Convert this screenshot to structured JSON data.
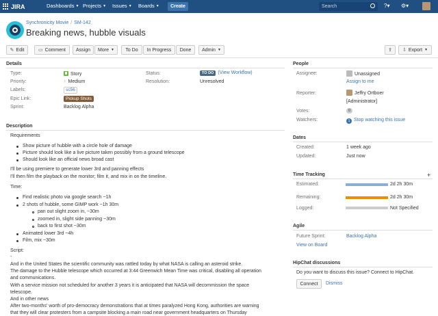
{
  "nav": {
    "logo": "JIRA",
    "items": [
      "Dashboards",
      "Projects",
      "Issues",
      "Boards"
    ],
    "create": "Create",
    "search_placeholder": "Search"
  },
  "issue": {
    "project": "Synchronicity Movie",
    "key": "SM-142",
    "title": "Breaking news, hubble visuals"
  },
  "toolbar": {
    "edit": "Edit",
    "comment": "Comment",
    "assign": "Assign",
    "more": "More",
    "todo": "To Do",
    "in_progress": "In Progress",
    "done": "Done",
    "admin": "Admin",
    "export": "Export"
  },
  "details": {
    "heading": "Details",
    "type_label": "Type:",
    "type": "Story",
    "priority_label": "Priority:",
    "priority": "Medium",
    "labels_label": "Labels:",
    "labels": "sc56",
    "epic_label": "Epic Link:",
    "epic": "Pickup Shots",
    "sprint_label": "Sprint:",
    "sprint": "Backlog Alpha",
    "status_label": "Status:",
    "status": "TO DO",
    "view_workflow": "(View Workflow)",
    "resolution_label": "Resolution:",
    "resolution": "Unresolved"
  },
  "description": {
    "heading": "Description",
    "requirements": "Requirements",
    "req_items": [
      "Show picture of hubble with a circle hole of damage",
      "Picture should look like a live picture taken possibly from a ground telescope",
      "Should look like an official news broad cast"
    ],
    "p1": "I'll be using premiere to generate lower 3rd and panning effects",
    "p2": "I'll then film the playback on the monitor; film it, and mix in on the timeline.",
    "time": "Time:",
    "time_items": [
      "Find realistic photo via google search ~1h",
      "2 shots of hubble, some GIMP work ~1h 30m",
      "Animated lower 3rd ~4h",
      "Film, mix ~30m"
    ],
    "sub_items": [
      "pan out slight zoom in, ~30m",
      "zoomed in, slight side panning ~30m",
      "back to first shot ~30m"
    ],
    "script": "Script:",
    "dash": "-",
    "script_lines": [
      "And in the United States the scientific community was rattled today by what NASA is calling an asteroid strike.",
      "The damage to the Hubble telescope which occurred at 3:44 Greenwich Mean Time was critical, disabling all operation",
      "and communications.",
      "With a service mission not scheduled for another 3 years it is anticipated that NASA will decommission the space",
      "telescope.",
      "And in other news",
      "After two-months' worth of pro-democracy demonstrations that at times paralyzed Hong Kong, authorities are warning",
      "that they will clear protesters from a campsite blocking a main road near government headquarters on Thursday"
    ]
  },
  "people": {
    "heading": "People",
    "assignee_label": "Assignee:",
    "assignee": "Unassigned",
    "assign_me": "Assign to me",
    "reporter_label": "Reporter:",
    "reporter": "Jeffry Ortboer",
    "reporter_role": "[Administrator]",
    "votes_label": "Votes:",
    "votes": "0",
    "watchers_label": "Watchers:",
    "watchers_count": "1",
    "stop_watching": "Stop watching this issue"
  },
  "dates": {
    "heading": "Dates",
    "created_label": "Created:",
    "created": "1 week ago",
    "updated_label": "Updated:",
    "updated": "Just now"
  },
  "time_tracking": {
    "heading": "Time Tracking",
    "estimated_label": "Estimated:",
    "estimated": "2d 2h 30m",
    "estimated_fill": 1.0,
    "remaining_label": "Remaining:",
    "remaining": "2d 2h 30m",
    "remaining_fill": 1.0,
    "logged_label": "Logged:",
    "logged": "Not Specified",
    "logged_fill": 0.0,
    "colors": {
      "estimated": "#89afd7",
      "remaining": "#ec8e00",
      "logged": "#cccccc"
    }
  },
  "agile": {
    "heading": "Agile",
    "future_label": "Future Sprint:",
    "future": "Backlog Alpha",
    "view_board": "View on Board"
  },
  "hipchat": {
    "heading": "HipChat discussions",
    "prompt": "Do you want to discuss this issue? Connect to HipChat.",
    "connect": "Connect",
    "dismiss": "Dismiss"
  }
}
